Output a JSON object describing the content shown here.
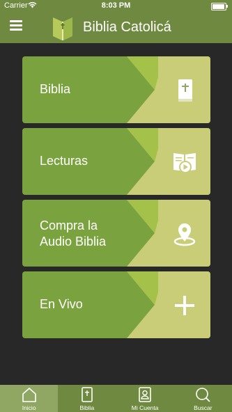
{
  "status_bar": {
    "carrier": "Carrier",
    "time": "8:03 PM"
  },
  "header": {
    "title": "Biblia Catolicá"
  },
  "menu": {
    "items": [
      {
        "label": "Biblia",
        "icon": "bible-icon"
      },
      {
        "label": "Lecturas",
        "icon": "reading-play-icon"
      },
      {
        "label": "Compra la Audio Biblia",
        "icon": "location-pin-icon"
      },
      {
        "label": "En Vivo",
        "icon": "plus-icon"
      }
    ]
  },
  "tab_bar": {
    "tabs": [
      {
        "label": "Inicio",
        "icon": "home-icon",
        "active": true
      },
      {
        "label": "Biblia",
        "icon": "bible-icon",
        "active": false
      },
      {
        "label": "Mi Cuenta",
        "icon": "account-icon",
        "active": false
      },
      {
        "label": "Buscar",
        "icon": "search-icon",
        "active": false
      }
    ]
  },
  "colors": {
    "bar": "#6f8a40",
    "background": "#282828",
    "card_dark": "#7aa23e",
    "card_light": "#c9cd78",
    "active_tab": "#8fa763"
  }
}
